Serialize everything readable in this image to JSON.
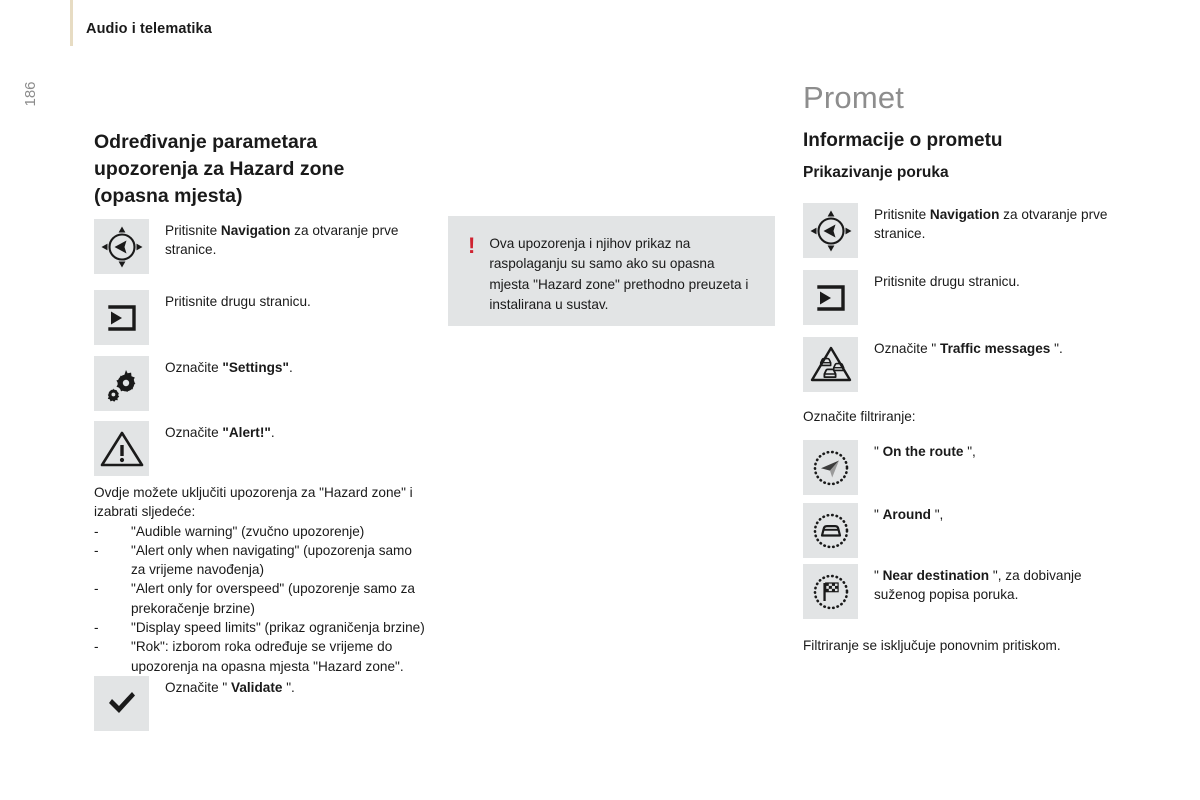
{
  "header": {
    "title": "Audio i telematika",
    "page_number": "186"
  },
  "left_column": {
    "section_title": "Određivanje parametara upozorenja za Hazard zone (opasna mjesta)",
    "steps": [
      {
        "icon": "navigation-pad-icon",
        "text_parts": [
          {
            "text": "Pritisnite ",
            "bold": false
          },
          {
            "text": "Navigation",
            "bold": true
          },
          {
            "text": " za otvaranje prve stranice.",
            "bold": false
          }
        ]
      },
      {
        "icon": "second-page-icon",
        "text_parts": [
          {
            "text": "Pritisnite drugu stranicu.",
            "bold": false
          }
        ]
      },
      {
        "icon": "settings-gears-icon",
        "text_parts": [
          {
            "text": "Označite ",
            "bold": false
          },
          {
            "text": "\"Settings\"",
            "bold": true
          },
          {
            "text": ".",
            "bold": false
          }
        ]
      },
      {
        "icon": "alert-triangle-icon",
        "text_parts": [
          {
            "text": "Označite ",
            "bold": false
          },
          {
            "text": "\"Alert!\"",
            "bold": true
          },
          {
            "text": ".",
            "bold": false
          }
        ]
      }
    ],
    "body_intro": "Ovdje možete uključiti upozorenja za \"Hazard zone\" i izabrati sljedeće:",
    "bullet_marker": "-",
    "bullets": [
      "\"Audible warning\" (zvučno upozorenje)",
      "\"Alert only when navigating\" (upozorenja samo za vrijeme navođenja)",
      "\"Alert only for overspeed\" (upozorenje samo za prekoračenje brzine)",
      "\"Display speed limits\" (prikaz ograničenja brzine)",
      "\"Rok\": izborom roka određuje se vrijeme do upozorenja na opasna mjesta \"Hazard zone\"."
    ],
    "validate_step": {
      "icon": "checkmark-icon",
      "text_parts": [
        {
          "text": "Označite \" ",
          "bold": false
        },
        {
          "text": "Validate",
          "bold": true
        },
        {
          "text": " \".",
          "bold": false
        }
      ]
    }
  },
  "callout": {
    "marker": "!",
    "marker_color": "#cf2230",
    "background": "#e2e4e5",
    "text": "Ova upozorenja i njihov prikaz na raspolaganju su samo ako su opasna mjesta \"Hazard zone\" prethodno preuzeta i instalirana u sustav."
  },
  "right_column": {
    "chapter_title": "Promet",
    "section_title": "Informacije o prometu",
    "subsection_title": "Prikazivanje poruka",
    "steps": [
      {
        "icon": "navigation-pad-icon",
        "text_parts": [
          {
            "text": "Pritisnite ",
            "bold": false
          },
          {
            "text": "Navigation",
            "bold": true
          },
          {
            "text": " za otvaranje prve stranice.",
            "bold": false
          }
        ]
      },
      {
        "icon": "second-page-icon",
        "text_parts": [
          {
            "text": "Pritisnite drugu stranicu.",
            "bold": false
          }
        ]
      },
      {
        "icon": "traffic-jam-icon",
        "text_parts": [
          {
            "text": "Označite \" ",
            "bold": false
          },
          {
            "text": "Traffic messages",
            "bold": true
          },
          {
            "text": " \".",
            "bold": false
          }
        ]
      }
    ],
    "filter_intro": "Označite filtriranje:",
    "filter_steps": [
      {
        "icon": "route-arrow-icon",
        "text_parts": [
          {
            "text": "\" ",
            "bold": false
          },
          {
            "text": "On the route",
            "bold": true
          },
          {
            "text": " \",",
            "bold": false
          }
        ]
      },
      {
        "icon": "car-around-icon",
        "text_parts": [
          {
            "text": "\" ",
            "bold": false
          },
          {
            "text": "Around",
            "bold": true
          },
          {
            "text": " \",",
            "bold": false
          }
        ]
      },
      {
        "icon": "checkered-flag-icon",
        "text_parts": [
          {
            "text": "\" ",
            "bold": false
          },
          {
            "text": "Near destination",
            "bold": true
          },
          {
            "text": " \", za dobivanje suženog popisa poruka.",
            "bold": false
          }
        ]
      }
    ],
    "footer_note": "Filtriranje se isključuje ponovnim pritiskom."
  },
  "colors": {
    "page_background": "#ffffff",
    "icon_box_background": "#e2e4e5",
    "header_rule": "#e7dcc3",
    "chapter_title_gray": "#8d8d8d",
    "text": "#1a1a1a",
    "warning_red": "#cf2230"
  }
}
